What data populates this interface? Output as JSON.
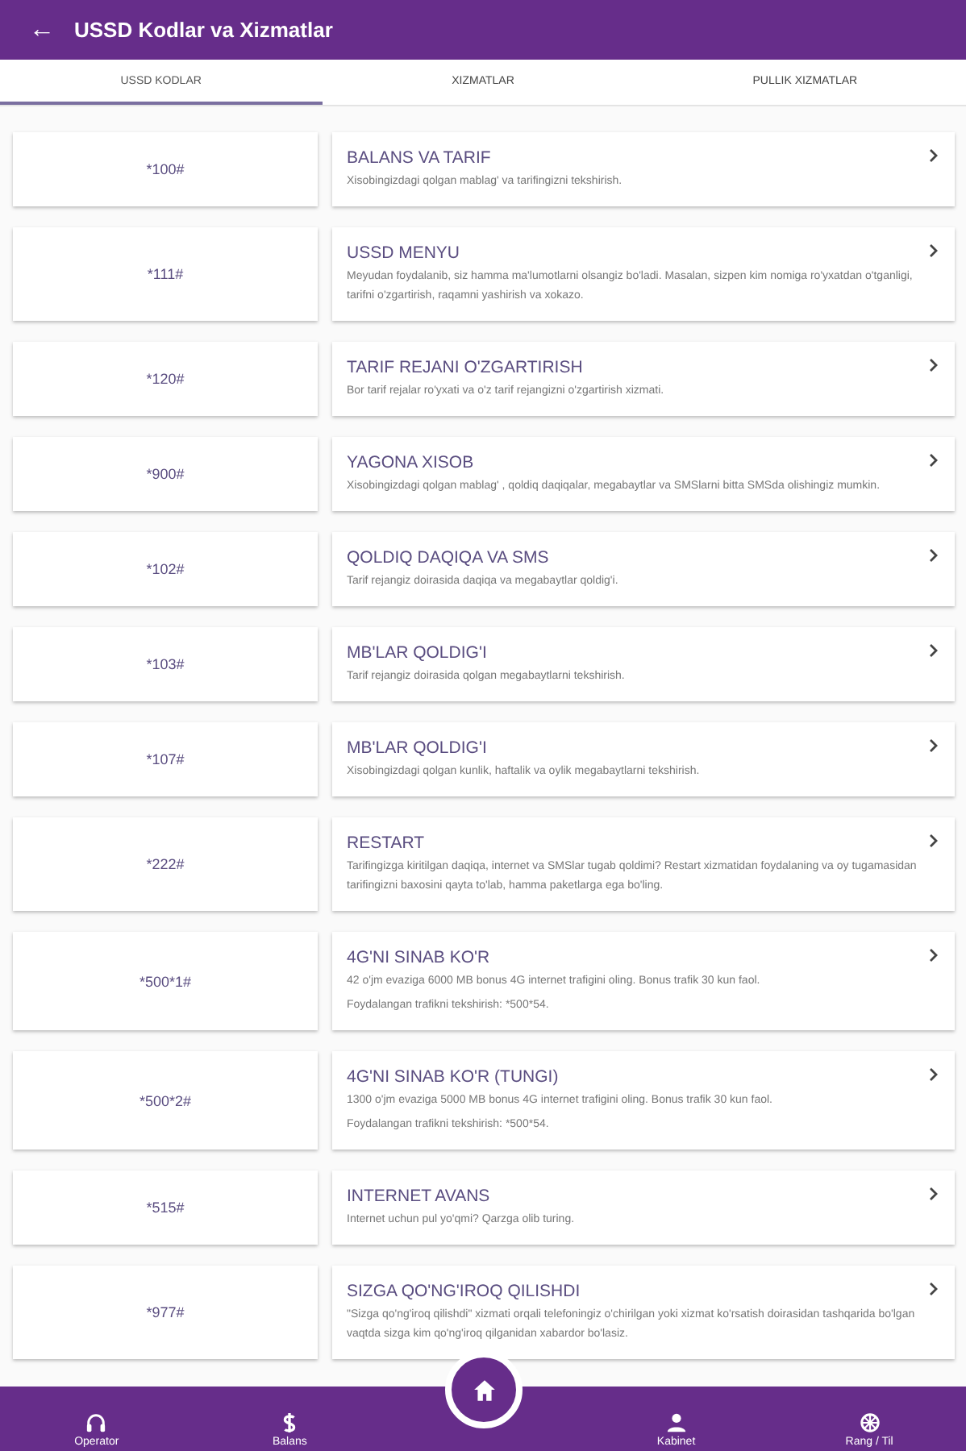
{
  "app_bar": {
    "back": "←",
    "title": "USSD Kodlar va Xizmatlar"
  },
  "tabs": [
    {
      "label": "USSD KODLAR",
      "selected": true
    },
    {
      "label": "XIZMATLAR",
      "selected": false
    },
    {
      "label": "PULLIK XIZMATLAR",
      "selected": false
    }
  ],
  "items": [
    {
      "code": "*100#",
      "title": "BALANS VA TARIF",
      "description": [
        "Xisobingizdagi qolgan mablag' va tarifingizni tekshirish."
      ]
    },
    {
      "code": "*111#",
      "title": "USSD MENYU",
      "description": [
        "Meyudan foydalanib, siz hamma ma'lumotlarni olsangiz bo'ladi. Masalan, sizpen kim nomiga ro'yxatdan o'tganligi, tarifni o'zgartirish, raqamni yashirish va xokazo."
      ]
    },
    {
      "code": "*120#",
      "title": "TARIF REJANI O'ZGARTIRISH",
      "description": [
        "Bor tarif rejalar ro'yxati va o'z tarif rejangizni o'zgartirish xizmati."
      ]
    },
    {
      "code": "*900#",
      "title": "YAGONA XISOB",
      "description": [
        "Xisobingizdagi qolgan mablag' , qoldiq daqiqalar, megabaytlar va SMSlarni bitta SMSda olishingiz mumkin."
      ]
    },
    {
      "code": "*102#",
      "title": "QOLDIQ DAQIQA VA SMS",
      "description": [
        "Tarif rejangiz doirasida daqiqa va megabaytlar qoldig'i."
      ]
    },
    {
      "code": "*103#",
      "title": "MB'LAR QOLDIG'I",
      "description": [
        "Tarif rejangiz doirasida qolgan megabaytlarni tekshirish."
      ]
    },
    {
      "code": "*107#",
      "title": "MB'LAR QOLDIG'I",
      "description": [
        "Xisobingizdagi qolgan kunlik, haftalik va oylik megabaytlarni tekshirish."
      ]
    },
    {
      "code": "*222#",
      "title": "RESTART",
      "description": [
        "Tarifingizga kiritilgan daqiqa, internet va SMSlar tugab qoldimi? Restart xizmatidan foydalaning va oy tugamasidan tarifingizni baxosini qayta to'lab, hamma paketlarga ega bo'ling."
      ]
    },
    {
      "code": "*500*1#",
      "title": "4G'NI SINAB KO'R",
      "description": [
        "42 o'jm evaziga 6000 MB bonus 4G internet trafigini oling. Bonus trafik 30 kun faol.",
        "Foydalangan trafikni tekshirish: *500*54."
      ]
    },
    {
      "code": "*500*2#",
      "title": "4G'NI SINAB KO'R (TUNGI)",
      "description": [
        "1300 o'jm evaziga 5000 MB bonus 4G internet trafigini oling. Bonus trafik 30 kun faol.",
        "Foydalangan trafikni tekshirish: *500*54."
      ]
    },
    {
      "code": "*515#",
      "title": "INTERNET AVANS",
      "description": [
        "Internet uchun pul yo'qmi? Qarzga olib turing."
      ]
    },
    {
      "code": "*977#",
      "title": "SIZGA QO'NG'IROQ QILISHDI",
      "description": [
        "\"Sizga qo'ng'iroq qilishdi\" xizmati orqali telefoningiz o'chirilgan yoki xizmat ko'rsatish doirasidan tashqarida bo'lgan vaqtda sizga kim qo'ng'iroq qilganidan xabardor bo'lasiz."
      ]
    }
  ],
  "bottom_nav": [
    {
      "kind": "headphones",
      "label": "Operator"
    },
    {
      "kind": "dollar",
      "label": "Balans"
    },
    {
      "kind": "home"
    },
    {
      "kind": "person",
      "label": "Kabinet"
    },
    {
      "kind": "wheel",
      "label": "Rang / Til"
    }
  ]
}
